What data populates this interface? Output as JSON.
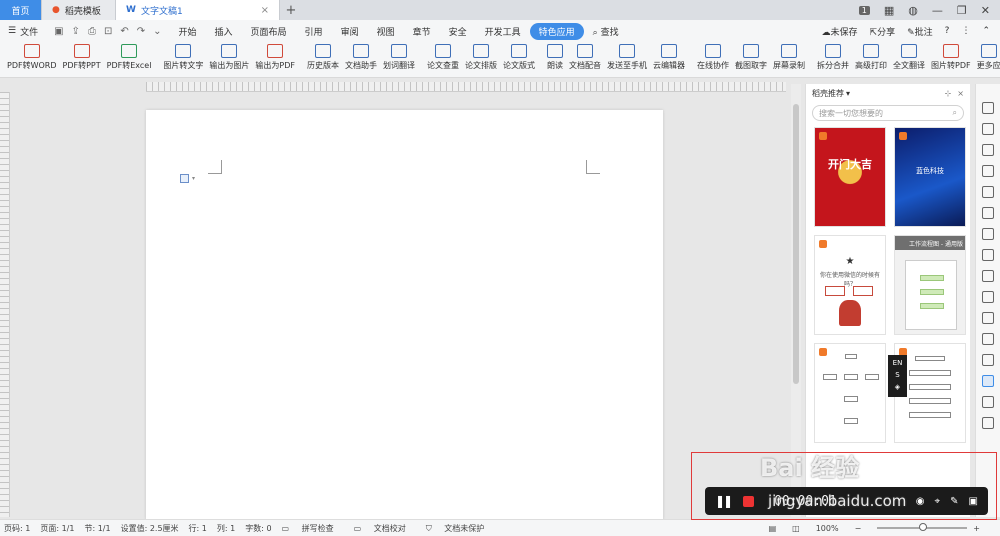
{
  "tabs": {
    "home": "首页",
    "daoke": "稻壳模板",
    "doc": "文字文稿1",
    "add": "+",
    "badge": "1"
  },
  "menu": {
    "file": "文件",
    "items": [
      "开始",
      "插入",
      "页面布局",
      "引用",
      "审阅",
      "视图",
      "章节",
      "安全",
      "开发工具"
    ],
    "active": "特色应用",
    "search": "查找",
    "unsaved": "未保存",
    "share": "分享",
    "annotate": "批注"
  },
  "ribbon": {
    "buttons": [
      "PDF转WORD",
      "PDF转PPT",
      "PDF转Excel",
      "图片转文字",
      "输出为图片",
      "输出为PDF",
      "历史版本",
      "文档助手",
      "划词翻译",
      "论文查重",
      "论文排版",
      "论文版式",
      "朗读",
      "文档配音",
      "发送至手机",
      "云编辑器",
      "在线协作",
      "截图取字",
      "屏幕录制",
      "拆分合并",
      "高级打印",
      "全文翻译",
      "图片转PDF",
      "更多应"
    ]
  },
  "ruler": {
    "top_numbers": "| 6 | 4 | 2 | | 2 | 4 | 6 | 8 | 10 | 12 | 14 | 16 | 18 | 20 | 22 | 24 | 26 | 28 | 30 | 32 | 34 | 36 | 38 | | 42 | 44 | 46 |"
  },
  "panel": {
    "title": "稻壳推荐",
    "search_placeholder": "搜索一切您想要的",
    "card_red_text": "开门大吉",
    "card_blue_text": "蓝色科技",
    "card_q_text": "你在使用微信的时候有吗？",
    "card_flow_title": "工作流程图 - 通用版"
  },
  "ime": {
    "line1": "EN",
    "line2": "S"
  },
  "status": {
    "page": "页码: 1",
    "pages": "页面: 1/1",
    "section": "节: 1/1",
    "setting": "设置值: 2.5厘米",
    "row": "行: 1",
    "col": "列: 1",
    "words": "字数: 0",
    "spell": "拼写检查",
    "proof": "文档校对",
    "protect": "文档未保护",
    "zoom": "100%"
  },
  "recorder": {
    "time": "00:00:01"
  },
  "watermark": {
    "line1": "Bai 经验",
    "line2": "jingyan.baidu.com"
  }
}
